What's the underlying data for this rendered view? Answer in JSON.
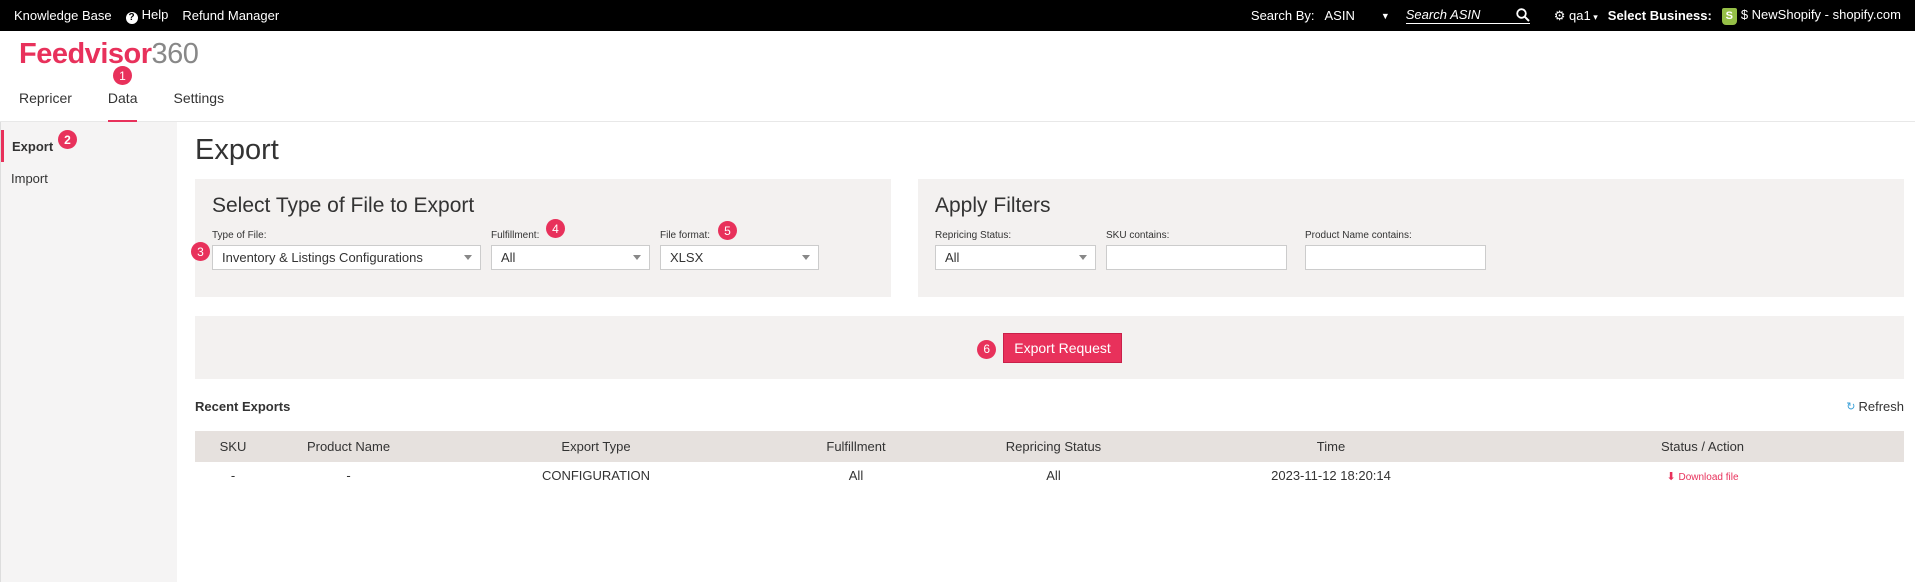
{
  "topbar": {
    "knowledge_base": "Knowledge Base",
    "help": "Help",
    "refund_manager": "Refund Manager",
    "search_by_label": "Search By:",
    "search_by_value": "ASIN",
    "search_placeholder": "Search ASIN",
    "user": "qa1",
    "select_business_label": "Select Business:",
    "business": "$ NewShopify - shopify.com"
  },
  "brand": {
    "name_colored": "Feedvisor",
    "name_number": "360"
  },
  "nav": {
    "tabs": [
      {
        "label": "Repricer"
      },
      {
        "label": "Data"
      },
      {
        "label": "Settings"
      }
    ]
  },
  "sidebar": {
    "items": [
      {
        "label": "Export"
      },
      {
        "label": "Import"
      }
    ]
  },
  "badges": [
    "1",
    "2",
    "3",
    "4",
    "5",
    "6"
  ],
  "main": {
    "title": "Export",
    "file_panel": {
      "title": "Select Type of File to Export",
      "type_label": "Type of File:",
      "type_value": "Inventory & Listings Configurations",
      "fulfillment_label": "Fulfillment:",
      "fulfillment_value": "All",
      "format_label": "File format:",
      "format_value": "XLSX"
    },
    "filters_panel": {
      "title": "Apply Filters",
      "repricing_label": "Repricing Status:",
      "repricing_value": "All",
      "sku_label": "SKU contains:",
      "product_label": "Product Name contains:"
    },
    "export_button": "Export Request",
    "recent": {
      "title": "Recent Exports",
      "refresh": "Refresh",
      "columns": [
        "SKU",
        "Product Name",
        "Export Type",
        "Fulfillment",
        "Repricing Status",
        "Time",
        "Status / Action"
      ],
      "rows": [
        {
          "sku": "-",
          "product": "-",
          "type": "CONFIGURATION",
          "fulfillment": "All",
          "repricing": "All",
          "time": "2023-11-12 18:20:14",
          "action": "Download file"
        }
      ]
    }
  },
  "colors": {
    "accent": "#e8315b",
    "panel_bg": "#f3f1f0",
    "table_header": "#e6e1de"
  }
}
